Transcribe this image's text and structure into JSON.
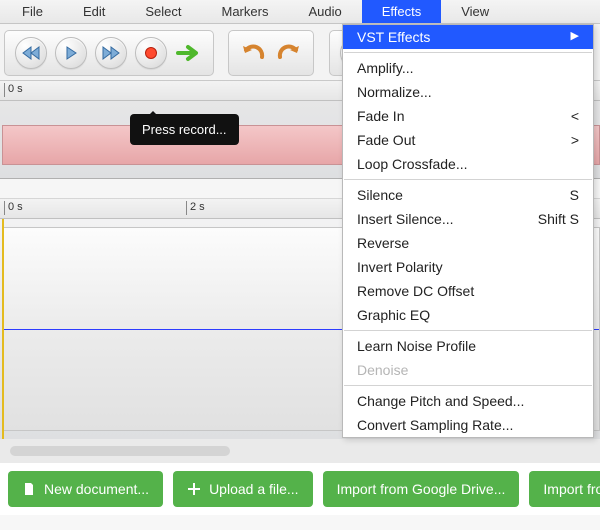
{
  "menu": {
    "items": [
      "File",
      "Edit",
      "Select",
      "Markers",
      "Audio",
      "Effects",
      "View"
    ],
    "open_index": 5
  },
  "dropdown": {
    "groups": [
      [
        {
          "label": "VST Effects",
          "submenu": true,
          "highlight": true
        }
      ],
      [
        {
          "label": "Amplify..."
        },
        {
          "label": "Normalize..."
        },
        {
          "label": "Fade In",
          "shortcut": "<"
        },
        {
          "label": "Fade Out",
          "shortcut": ">"
        },
        {
          "label": "Loop Crossfade..."
        }
      ],
      [
        {
          "label": "Silence",
          "shortcut": "S"
        },
        {
          "label": "Insert Silence...",
          "shortcut": "Shift S"
        },
        {
          "label": "Reverse"
        },
        {
          "label": "Invert Polarity"
        },
        {
          "label": "Remove DC Offset"
        },
        {
          "label": "Graphic EQ"
        }
      ],
      [
        {
          "label": "Learn Noise Profile"
        },
        {
          "label": "Denoise",
          "disabled": true
        }
      ],
      [
        {
          "label": "Change Pitch and Speed..."
        },
        {
          "label": "Convert Sampling Rate..."
        }
      ]
    ]
  },
  "tooltip": "Press record...",
  "ruler1_ticks": [
    "0 s"
  ],
  "ruler2_ticks": [
    "0 s",
    "2 s"
  ],
  "actions": {
    "new": "New document...",
    "upload": "Upload a file...",
    "gdrive": "Import from Google Drive...",
    "soundcloud": "Import from So"
  }
}
